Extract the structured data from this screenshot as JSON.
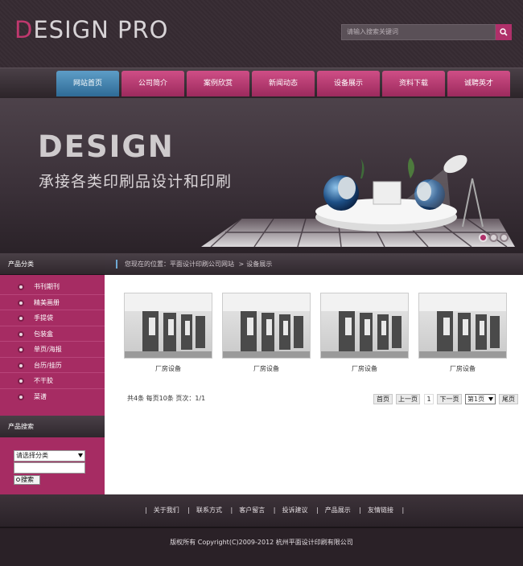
{
  "header": {
    "logo_first": "D",
    "logo_rest": "ESIGN PRO",
    "search_placeholder": "请输入搜索关键词"
  },
  "nav": [
    {
      "label": "网站首页",
      "active": true
    },
    {
      "label": "公司简介"
    },
    {
      "label": "案例欣赏"
    },
    {
      "label": "新闻动态"
    },
    {
      "label": "设备展示"
    },
    {
      "label": "资料下载"
    },
    {
      "label": "诚聘英才"
    }
  ],
  "banner": {
    "title": "DESIGN",
    "subtitle": "承接各类印刷品设计和印刷",
    "slides": 3,
    "active_slide": 1
  },
  "sidebar": {
    "category_heading": "产品分类",
    "categories": [
      "书刊期刊",
      "精美画册",
      "手提袋",
      "包装盒",
      "单页/海报",
      "台历/挂历",
      "不干胶",
      "菜谱"
    ],
    "search_heading": "产品搜索",
    "select_value": "请选择分类",
    "search_button": "搜索"
  },
  "breadcrumb": {
    "prefix": "您现在的位置：",
    "site": "平面设计印刷公司网站",
    "separator": ">",
    "current": "设备展示"
  },
  "products": [
    {
      "caption": "厂房设备"
    },
    {
      "caption": "厂房设备"
    },
    {
      "caption": "厂房设备"
    },
    {
      "caption": "厂房设备"
    }
  ],
  "pagination": {
    "info": "共4条  每页10条  页次：1/1",
    "first": "首页",
    "prev": "上一页",
    "current": "1",
    "next": "下一页",
    "select": "第1页",
    "last": "尾页"
  },
  "footer": {
    "links": [
      "关于我们",
      "联系方式",
      "客户留言",
      "投诉建议",
      "产品展示",
      "友情链接"
    ],
    "copyright": "版权所有  Copyright(C)2009-2012 杭州平面设计印刷有限公司"
  },
  "colors": {
    "accent": "#b0306a",
    "nav_active": "#3f7fab",
    "background": "#2c2329"
  }
}
